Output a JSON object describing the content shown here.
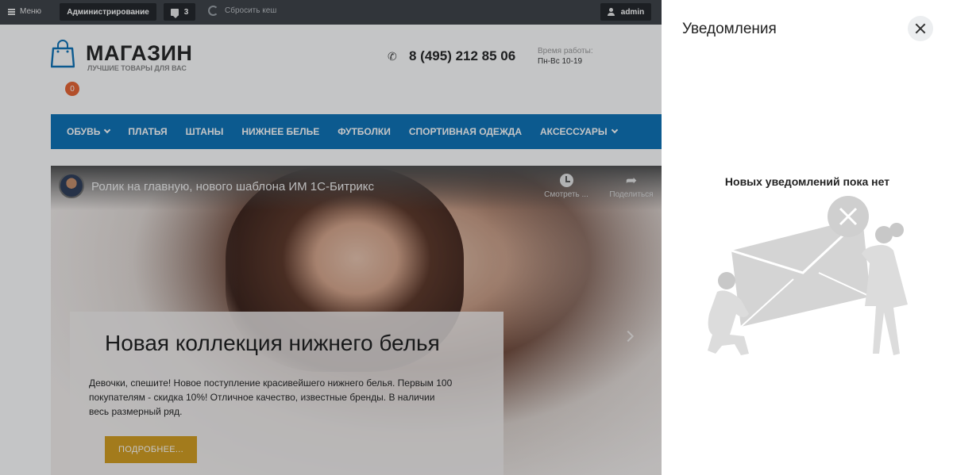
{
  "admin_bar": {
    "menu_label": "Меню",
    "admin_label": "Администрирование",
    "notifications_count": "3",
    "clear_cache_label": "Сбросить кеш",
    "user_label": "admin"
  },
  "header": {
    "logo_title": "МАГАЗИН",
    "logo_subtitle": "ЛУЧШИЕ ТОВАРЫ ДЛЯ ВАС",
    "cart_count": "0",
    "phone": "8 (495) 212 85 06",
    "hours_label": "Время работы:",
    "hours_value": "Пн-Вс 10-19"
  },
  "nav": {
    "items": [
      {
        "label": "ОБУВЬ"
      },
      {
        "label": "ПЛАТЬЯ"
      },
      {
        "label": "ШТАНЫ"
      },
      {
        "label": "НИЖНЕЕ БЕЛЬЕ"
      },
      {
        "label": "ФУТБОЛКИ"
      },
      {
        "label": "СПОРТИВНАЯ ОДЕЖДА"
      },
      {
        "label": "АКСЕССУАРЫ"
      }
    ]
  },
  "hero": {
    "video_title": "Ролик на главную, нового шаблона ИМ 1С-Битрикс",
    "watch_label": "Смотреть ...",
    "share_label": "Поделиться",
    "heading": "Новая коллекция нижнего белья",
    "text": "Девочки, спешите! Новое поступление красивейшего нижнего белья. Первым 100 покупателям - скидка 10%! Отличное качество, известные бренды. В наличии весь размерный ряд.",
    "button_label": "ПОДРОБНЕЕ..."
  },
  "notifications_panel": {
    "title": "Уведомления",
    "empty_text": "Новых уведомлений пока нет"
  },
  "colors": {
    "admin_bar": "#3b3f45",
    "nav": "#0a70b6",
    "accent_button": "#d39d1d",
    "cart_badge": "#e8622f"
  }
}
